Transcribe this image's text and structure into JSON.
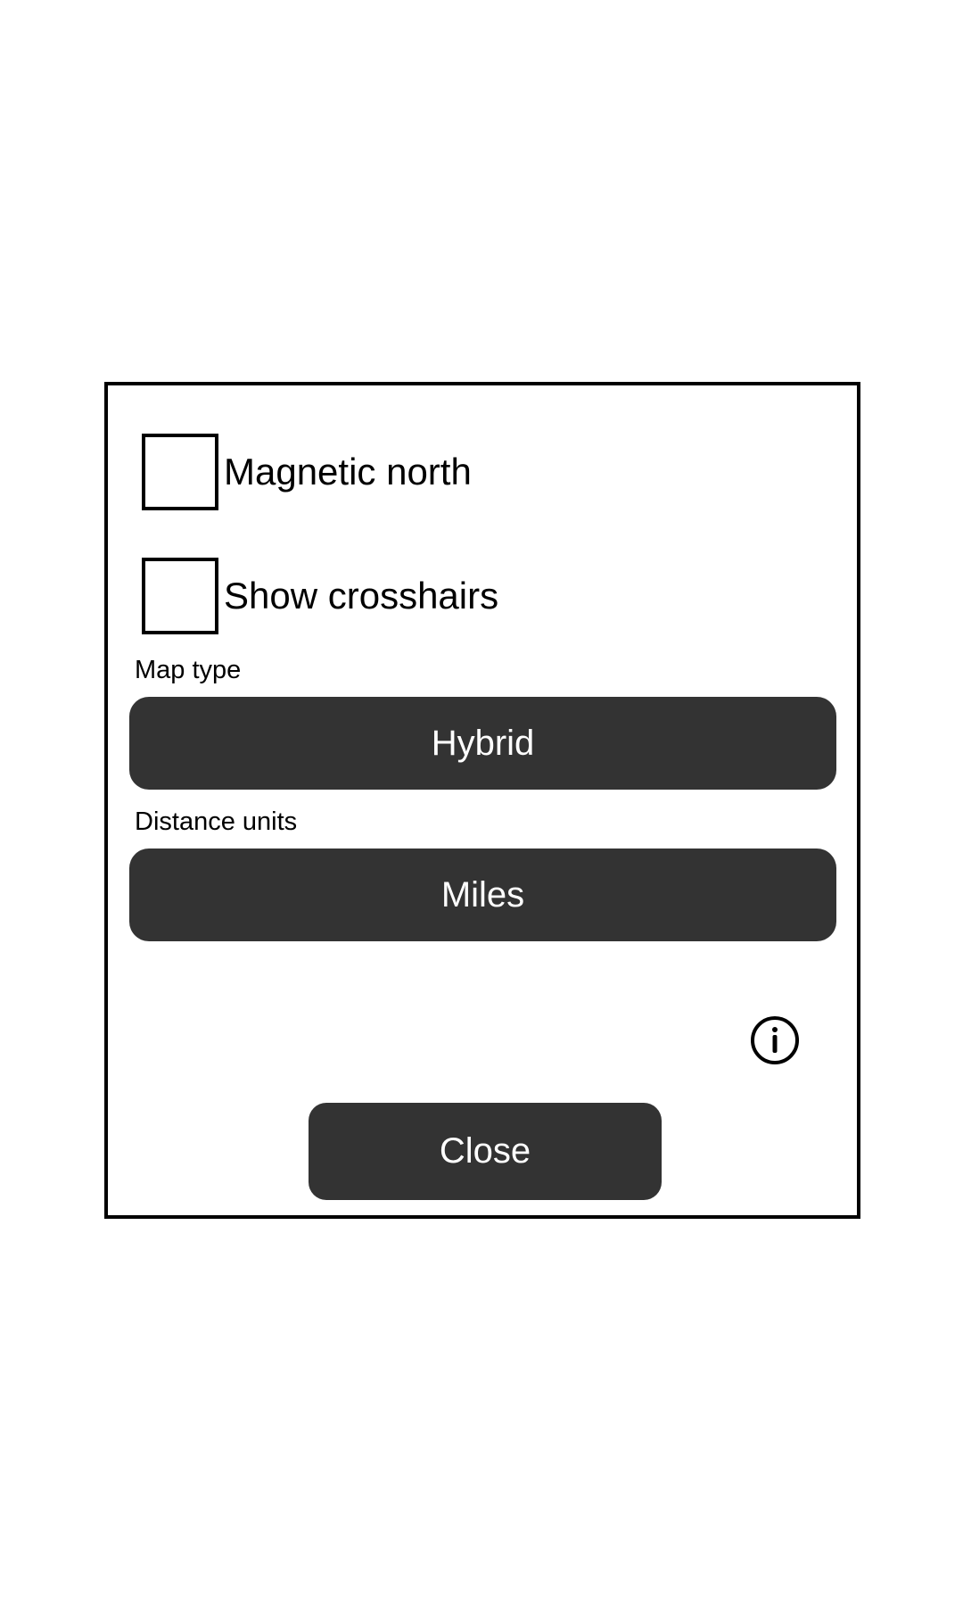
{
  "settings": {
    "magnetic_north": {
      "label": "Magnetic north",
      "checked": false
    },
    "show_crosshairs": {
      "label": "Show crosshairs",
      "checked": false
    },
    "map_type": {
      "label": "Map type",
      "value": "Hybrid"
    },
    "distance_units": {
      "label": "Distance units",
      "value": "Miles"
    },
    "close_label": "Close",
    "info_icon": "info-circle-icon"
  },
  "colors": {
    "button_bg": "#333333",
    "button_text": "#ffffff",
    "border": "#000000",
    "background": "#ffffff"
  }
}
